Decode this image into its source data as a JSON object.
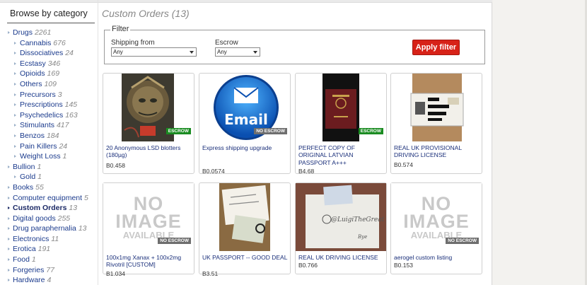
{
  "sidebar": {
    "heading": "Browse by category",
    "categories": [
      {
        "label": "Drugs",
        "count": "2261",
        "level": "top"
      },
      {
        "label": "Cannabis",
        "count": "676",
        "level": "sub"
      },
      {
        "label": "Dissociatives",
        "count": "24",
        "level": "sub"
      },
      {
        "label": "Ecstasy",
        "count": "346",
        "level": "sub"
      },
      {
        "label": "Opioids",
        "count": "169",
        "level": "sub"
      },
      {
        "label": "Others",
        "count": "109",
        "level": "sub"
      },
      {
        "label": "Precursors",
        "count": "3",
        "level": "sub"
      },
      {
        "label": "Prescriptions",
        "count": "145",
        "level": "sub"
      },
      {
        "label": "Psychedelics",
        "count": "163",
        "level": "sub"
      },
      {
        "label": "Stimulants",
        "count": "417",
        "level": "sub"
      },
      {
        "label": "Benzos",
        "count": "184",
        "level": "sub"
      },
      {
        "label": "Pain Killers",
        "count": "24",
        "level": "sub"
      },
      {
        "label": "Weight Loss",
        "count": "1",
        "level": "sub"
      },
      {
        "label": "Bullion",
        "count": "1",
        "level": "top"
      },
      {
        "label": "Gold",
        "count": "1",
        "level": "sub"
      },
      {
        "label": "Books",
        "count": "55",
        "level": "top"
      },
      {
        "label": "Computer equipment",
        "count": "5",
        "level": "top"
      },
      {
        "label": "Custom Orders",
        "count": "13",
        "level": "top",
        "active": true
      },
      {
        "label": "Digital goods",
        "count": "255",
        "level": "top"
      },
      {
        "label": "Drug paraphernalia",
        "count": "13",
        "level": "top"
      },
      {
        "label": "Electronics",
        "count": "11",
        "level": "top"
      },
      {
        "label": "Erotica",
        "count": "191",
        "level": "top"
      },
      {
        "label": "Food",
        "count": "1",
        "level": "top"
      },
      {
        "label": "Forgeries",
        "count": "77",
        "level": "top"
      },
      {
        "label": "Hardware",
        "count": "4",
        "level": "top"
      }
    ]
  },
  "main": {
    "title": "Custom Orders (13)"
  },
  "filter": {
    "legend": "Filter",
    "shipping_label": "Shipping from",
    "shipping_value": "Any",
    "escrow_label": "Escrow",
    "escrow_value": "Any",
    "apply_label": "Apply filter"
  },
  "colors": {
    "link": "#1a3a8c",
    "escrow_badge": "#1b8c22",
    "noescrow_badge": "#6e6e6e",
    "apply_button": "#d72218"
  },
  "listings": [
    {
      "title": "20 Anonymous LSD blotters (180µg)",
      "price": "B0.458",
      "badge": "ESCROW",
      "thumb": "lsd-blotter-art"
    },
    {
      "title": "Express shipping upgrade",
      "price": "B0.0574",
      "badge": "NO ESCROW",
      "thumb": "email-icon",
      "thumb_text": "Email"
    },
    {
      "title": "PERFECT COPY OF ORIGINAL LATVIAN PASSPORT A+++",
      "price": "B4.68",
      "badge": "ESCROW",
      "thumb": "passport-photo"
    },
    {
      "title": "REAL UK PROVISIONAL DRIVING LICENSE",
      "price": "B0.574",
      "badge": "",
      "thumb": "id-card-photo"
    },
    {
      "title": "100x1mg Xanax + 100x2mg Rivotril [CUSTOM]",
      "price": "B1.034",
      "badge": "NO ESCROW",
      "thumb": "no-image",
      "thumb_text": [
        "NO",
        "IMAGE",
        "AVAILABLE"
      ]
    },
    {
      "title": "UK PASSPORT -- GOOD DEAL",
      "price": "B3.51",
      "badge": "",
      "thumb": "passport-note-photo"
    },
    {
      "title": "REAL UK DRIVING LICENSE",
      "price": "B0.766",
      "badge": "",
      "thumb": "license-note-photo"
    },
    {
      "title": "aerogel custom listing",
      "price": "B0.153",
      "badge": "NO ESCROW",
      "thumb": "no-image",
      "thumb_text": [
        "NO",
        "IMAGE",
        "AVAILABLE"
      ]
    }
  ]
}
